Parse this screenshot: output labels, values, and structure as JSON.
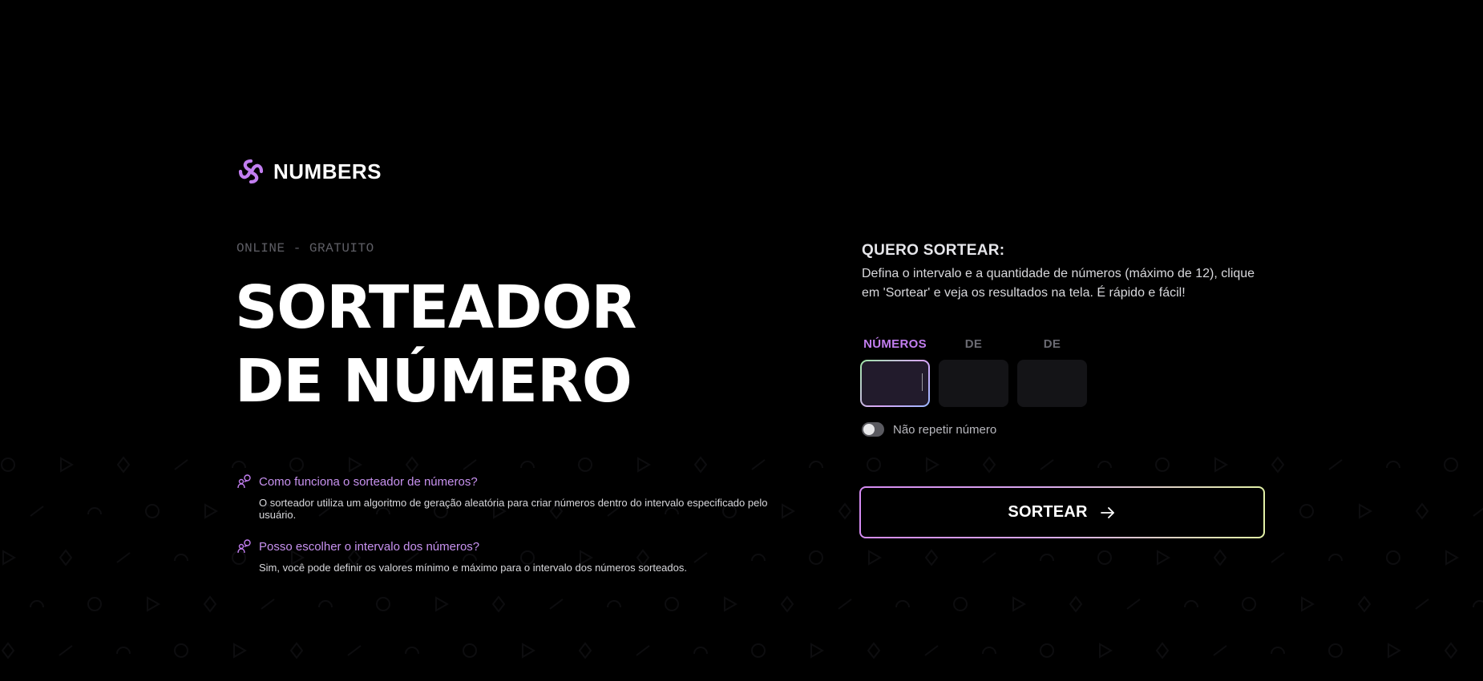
{
  "brand": {
    "name": "NUMBERS",
    "icon": "knot-logo-icon",
    "color": "#c27ef0"
  },
  "hero": {
    "eyebrow": "ONLINE - GRATUITO",
    "title_line1": "SORTEADOR",
    "title_line2": "DE NÚMERO"
  },
  "faq": [
    {
      "icon": "people-icon",
      "question": "Como funciona o sorteador de números?",
      "answer": "O sorteador utiliza um algoritmo de geração aleatória para criar números dentro do intervalo especificado pelo usuário."
    },
    {
      "icon": "people-icon",
      "question": "Posso escolher o intervalo dos números?",
      "answer": "Sim, você pode definir os valores mínimo e máximo para o intervalo dos números sorteados."
    }
  ],
  "form": {
    "title": "QUERO SORTEAR:",
    "description": "Defina o intervalo e a quantidade de números (máximo de 12), clique em 'Sortear' e veja os resultados na tela. É rápido e fácil!",
    "fields": [
      {
        "label": "NÚMEROS",
        "value": "",
        "active": true
      },
      {
        "label": "DE",
        "value": "",
        "active": false
      },
      {
        "label": "DE",
        "value": "",
        "active": false
      }
    ],
    "toggle": {
      "label": "Não repetir número",
      "on": false
    },
    "submit": {
      "label": "SORTEAR",
      "icon": "arrow-right-icon"
    }
  },
  "colors": {
    "background": "#000000",
    "accent": "#c27ef0",
    "muted": "#6a6a72"
  }
}
